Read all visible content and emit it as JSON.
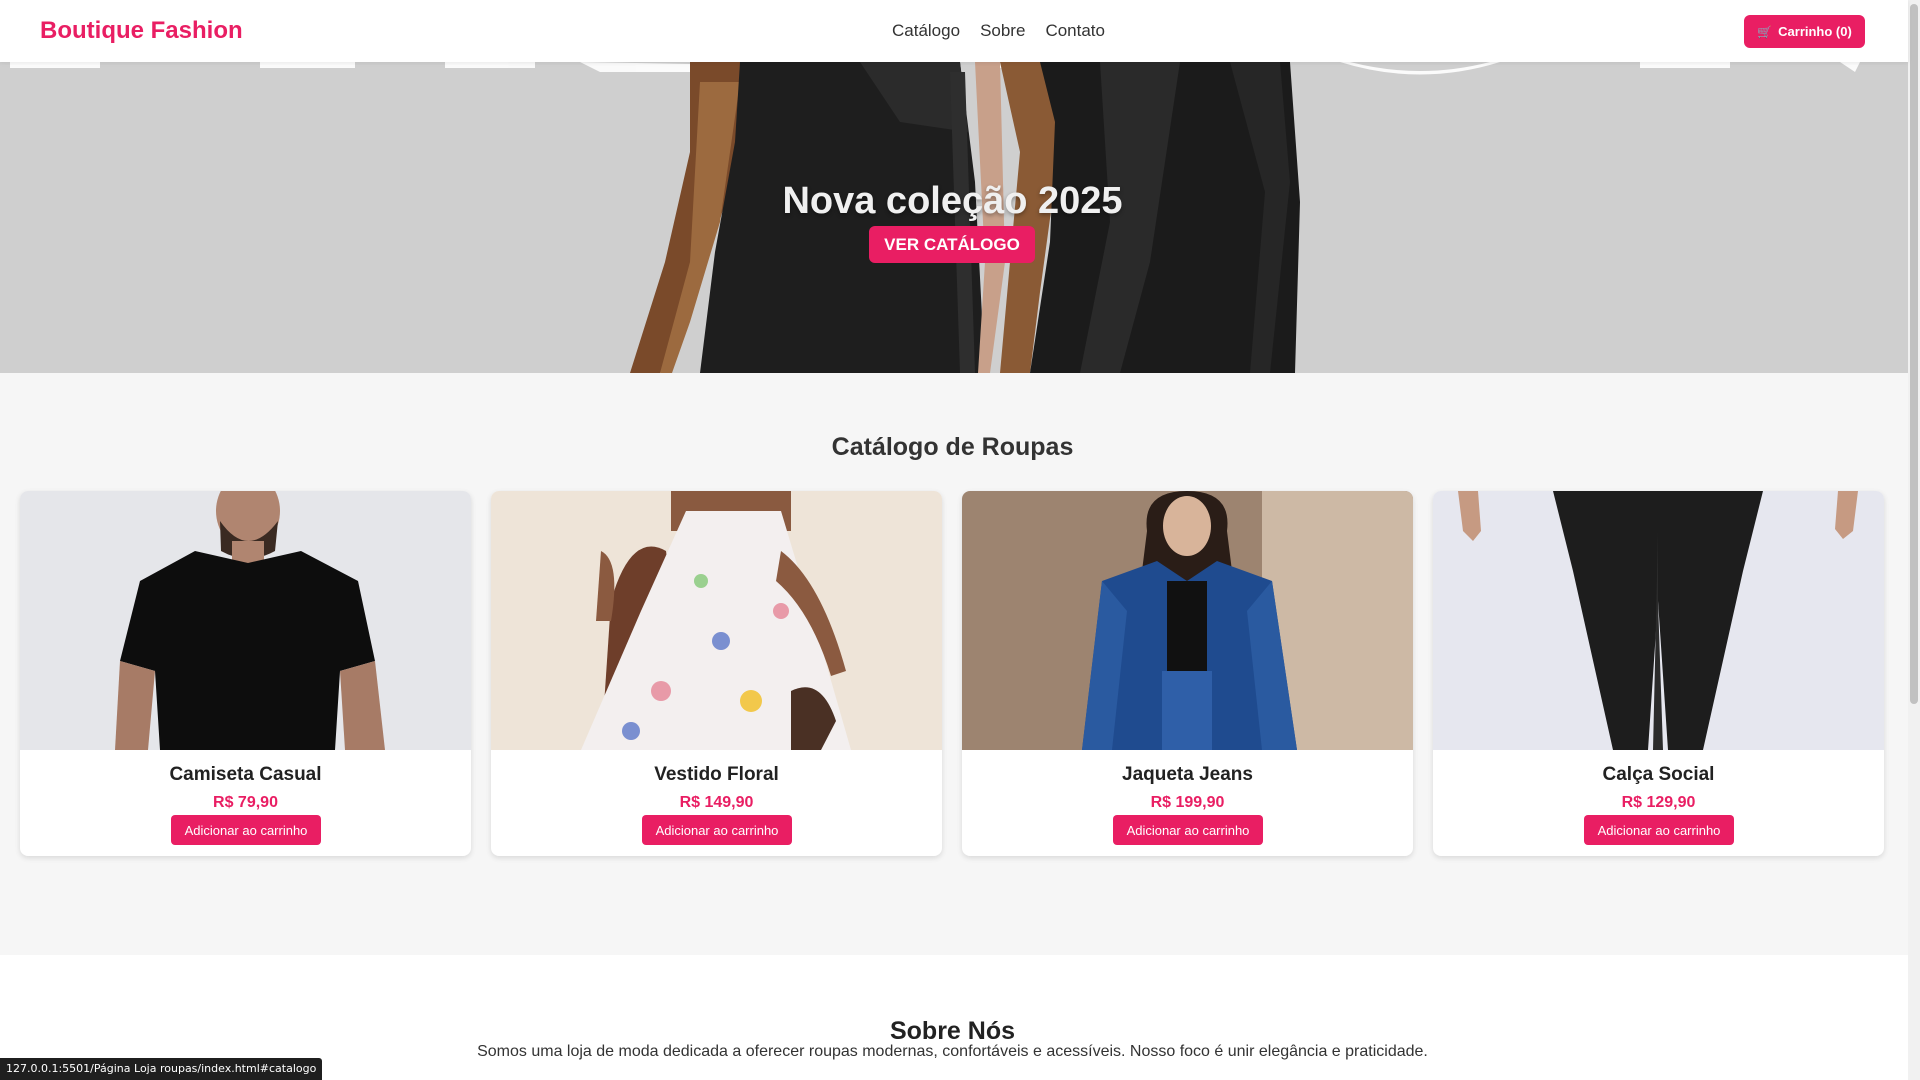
{
  "header": {
    "brand": "Boutique Fashion",
    "nav": [
      "Catálogo",
      "Sobre",
      "Contato"
    ],
    "cart_label": "Carrinho (0)",
    "cart_icon": "cart-icon"
  },
  "hero": {
    "title": "Nova coleção 2025",
    "button": "VER CATÁLOGO"
  },
  "catalog": {
    "title": "Catálogo de Roupas",
    "add_label": "Adicionar ao carrinho",
    "products": [
      {
        "name": "Camiseta Casual",
        "price": "R$ 79,90"
      },
      {
        "name": "Vestido Floral",
        "price": "R$ 149,90"
      },
      {
        "name": "Jaqueta Jeans",
        "price": "R$ 199,90"
      },
      {
        "name": "Calça Social",
        "price": "R$ 129,90"
      }
    ]
  },
  "about": {
    "title": "Sobre Nós",
    "text": "Somos uma loja de moda dedicada a oferecer roupas modernas, confortáveis e acessíveis. Nosso foco é unir elegância e praticidade."
  },
  "status_url": "127.0.0.1:5501/Página Loja roupas/index.html#catalogo",
  "colors": {
    "accent": "#e91e63",
    "hero_bg": "#cfcfcf",
    "page_bg": "#f6f6f6"
  }
}
